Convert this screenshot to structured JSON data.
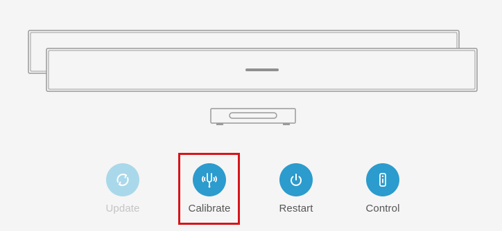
{
  "colors": {
    "accent": "#2c9bcd",
    "accent_disabled": "#a9d8ea",
    "highlight": "#d7141a",
    "device_outline": "#9a9a9a"
  },
  "actions": [
    {
      "key": "update",
      "label": "Update",
      "icon": "refresh-icon",
      "enabled": false
    },
    {
      "key": "calibrate",
      "label": "Calibrate",
      "icon": "tuning-fork-icon",
      "enabled": true,
      "highlighted": true
    },
    {
      "key": "restart",
      "label": "Restart",
      "icon": "power-icon",
      "enabled": true
    },
    {
      "key": "control",
      "label": "Control",
      "icon": "remote-control-icon",
      "enabled": true
    }
  ]
}
